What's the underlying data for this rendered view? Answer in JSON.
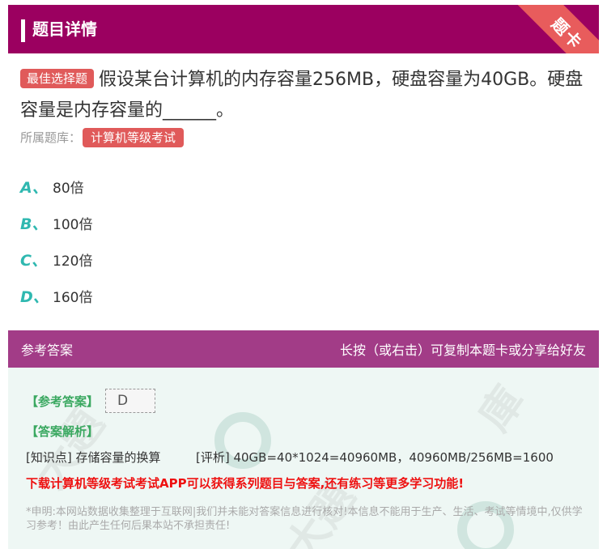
{
  "header": {
    "title": "题目详情",
    "ribbon_label": "题卡"
  },
  "question": {
    "badge": "最佳选择题",
    "text": "假设某台计算机的内存容量256MB，硬盘容量为40GB。硬盘容量是内存容量的______。"
  },
  "bank": {
    "label": "所属题库：",
    "name": "计算机等级考试"
  },
  "options": [
    {
      "letter": "A、",
      "text": "80倍"
    },
    {
      "letter": "B、",
      "text": "100倍"
    },
    {
      "letter": "C、",
      "text": "120倍"
    },
    {
      "letter": "D、",
      "text": "160倍"
    }
  ],
  "answer_header": {
    "left": "参考答案",
    "right": "长按（或右击）可复制本题卡或分享给好友"
  },
  "answer": {
    "ref_label": "【参考答案】",
    "ref_value": "D",
    "analysis_label": "【答案解析】",
    "knowledge": "[知识点] 存储容量的换算",
    "analysis": "[评析] 40GB=40*1024=40960MB，40960MB/256MB=1600",
    "promo": "下载计算机等级考试考试APP可以获得系列题目与答案,还有练习等更多学习功能!",
    "disclaimer": "*申明:本网站数据收集整理于互联网|我们并未能对答案信息进行核对!本信息不能用于生产、生活、考试等情境中,仅供学习参考！由此产生任何后果本站不承担责任!"
  },
  "colors": {
    "header_bg": "#9b0060",
    "answer_header_bg": "#a23c87",
    "badge": "#e05a5a",
    "option_letter": "#2fb8b0",
    "answer_green": "#3aa860",
    "promo_red": "#ee1111"
  }
}
